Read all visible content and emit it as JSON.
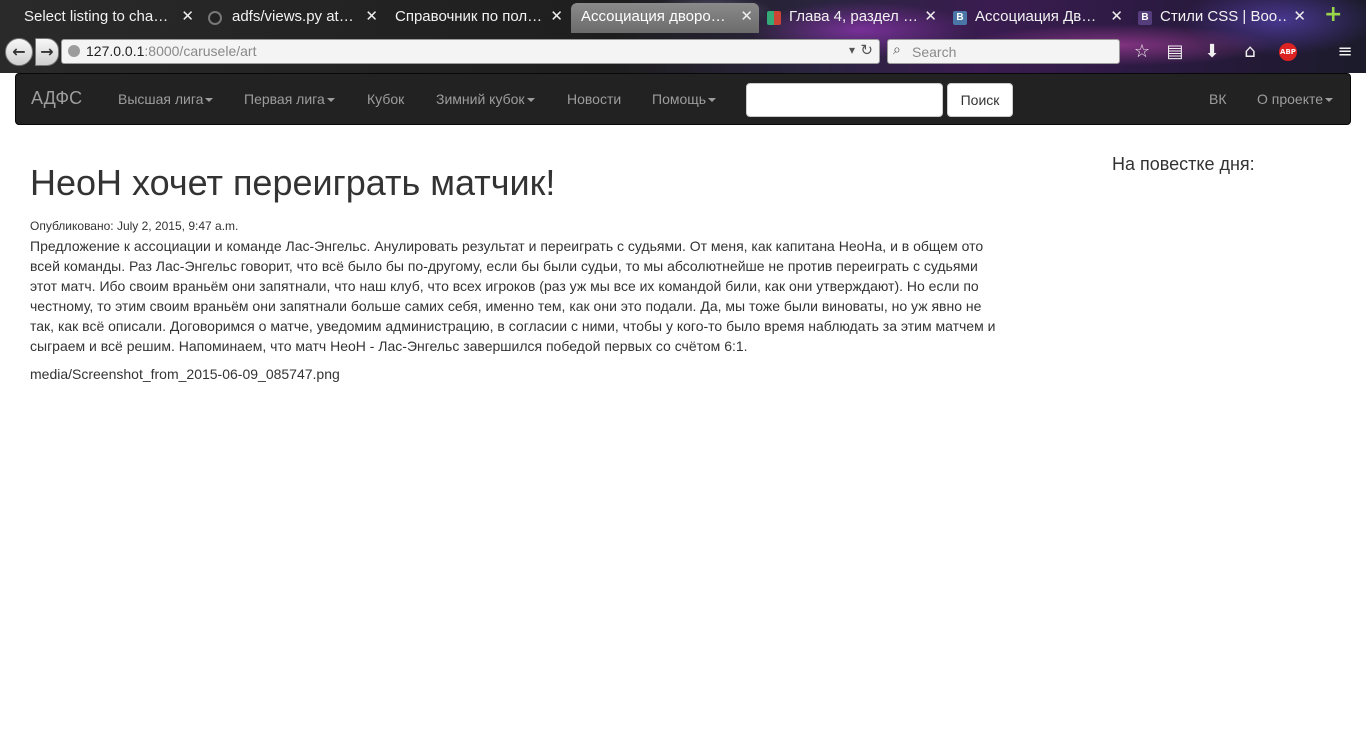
{
  "browser": {
    "tabs": [
      {
        "title": "Select listing to cha…"
      },
      {
        "title": "adfs/views.py at…"
      },
      {
        "title": "Справочник по пол…"
      },
      {
        "title": "Ассоциация дворо…"
      },
      {
        "title": "Глава 4, раздел …"
      },
      {
        "title": "Ассоциация Дв…"
      },
      {
        "title": "Стили CSS | Boo…"
      }
    ],
    "url_host": "127.0.0.1",
    "url_path": ":8000/carusele/art",
    "search_placeholder": "Search",
    "abp_label": "ABP"
  },
  "sitenav": {
    "brand": "АДФС",
    "items": [
      "Высшая лига",
      "Первая лига",
      "Кубок",
      "Зимний кубок",
      "Новости",
      "Помощь"
    ],
    "search_button": "Поиск",
    "right_items": [
      "ВК",
      "О проекте"
    ]
  },
  "article": {
    "title": "НеоН хочет переиграть матчик!",
    "published": "Опубликовано: July 2, 2015, 9:47 a.m.",
    "body": "Предложение к ассоциации и команде Лас-Энгельс. Анулировать результат и переиграть с судьями. От меня, как капитана НеоНа, и в общем ото всей команды. Раз Лас-Энгельс говорит, что всё было бы по-другому, если бы были судьи, то мы абсолютнейше не против переиграть с судьями этот матч. Ибо своим враньём они запятнали, что наш клуб, что всех игроков (раз уж мы все их командой били, как они утверждают). Но если по честному, то этим своим враньём они запятнали больше самих себя, именно тем, как они это подали. Да, мы тоже были виноваты, но уж явно не так, как всё описали. Договоримся о матче, уведомим администрацию, в согласии с ними, чтобы у кого-то было время наблюдать за этим матчем и сыграем и всё решим. Напоминаем, что матч НеоН - Лас-Энгельс завершился победой первых со счётом 6:1.",
    "media": "media/Screenshot_from_2015-06-09_085747.png"
  },
  "sidebar": {
    "heading": "На повестке дня:"
  }
}
